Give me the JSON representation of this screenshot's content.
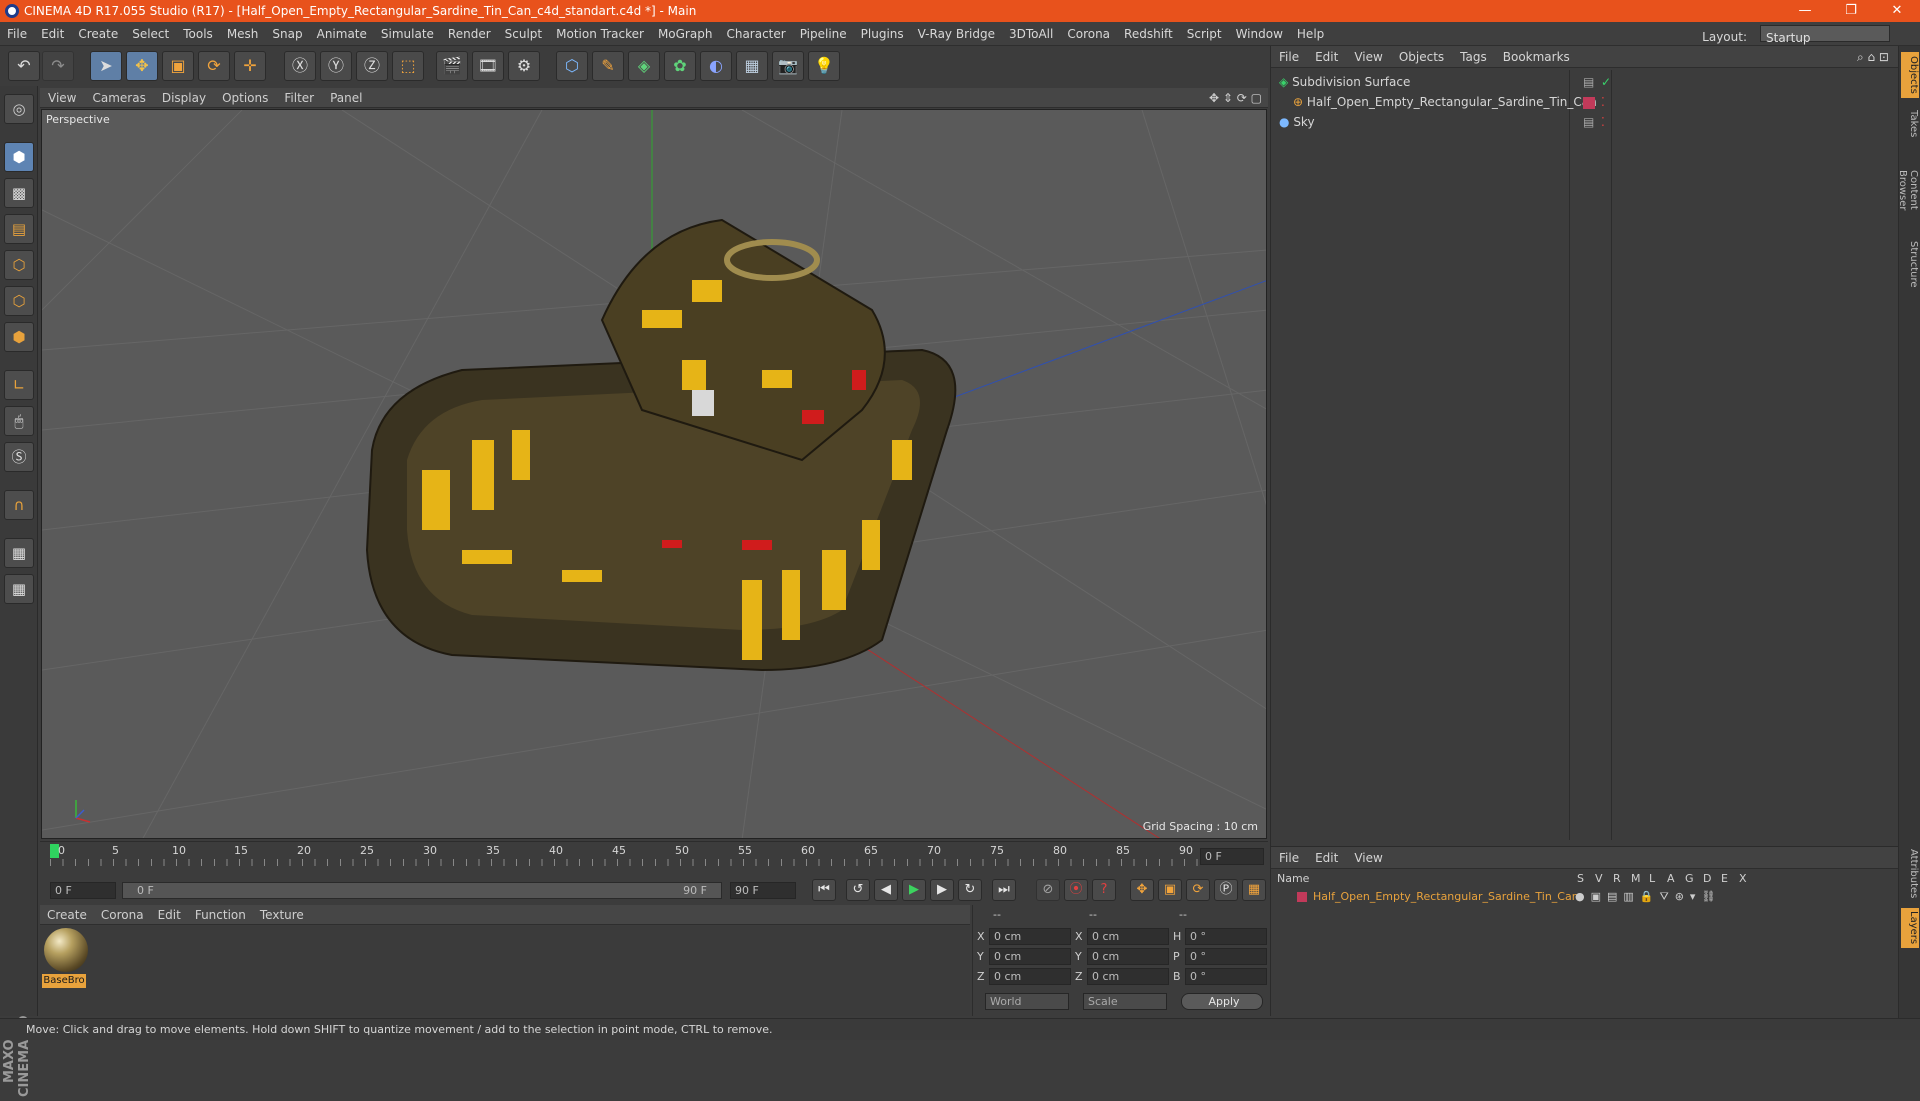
{
  "titlebar": {
    "title": "CINEMA 4D R17.055 Studio (R17) - [Half_Open_Empty_Rectangular_Sardine_Tin_Can_c4d_standart.c4d *] - Main",
    "minimize": "—",
    "restore": "❐",
    "close": "✕"
  },
  "menubar": {
    "items": [
      "File",
      "Edit",
      "Create",
      "Select",
      "Tools",
      "Mesh",
      "Snap",
      "Animate",
      "Simulate",
      "Render",
      "Sculpt",
      "Motion Tracker",
      "MoGraph",
      "Character",
      "Pipeline",
      "Plugins",
      "V-Ray Bridge",
      "3DToAll",
      "Corona",
      "Redshift",
      "Script",
      "Window",
      "Help"
    ],
    "layout_label": "Layout:",
    "layout_value": "Startup"
  },
  "viewport": {
    "menu": [
      "View",
      "Cameras",
      "Display",
      "Options",
      "Filter",
      "Panel"
    ],
    "label": "Perspective",
    "grid_spacing": "Grid Spacing : 10 cm"
  },
  "timeline": {
    "ticks": [
      "0",
      "5",
      "10",
      "15",
      "20",
      "25",
      "30",
      "35",
      "40",
      "45",
      "50",
      "55",
      "60",
      "65",
      "70",
      "75",
      "80",
      "85",
      "90"
    ],
    "frame_field": "0 F"
  },
  "transport": {
    "start": "0 F",
    "range_start": "0 F",
    "range_end": "90 F",
    "end": "90 F"
  },
  "material": {
    "menu": [
      "Create",
      "Corona",
      "Edit",
      "Function",
      "Texture"
    ],
    "name": "BaseBro"
  },
  "coordinates": {
    "header": [
      "--",
      "--",
      "--"
    ],
    "rows": [
      {
        "a": "X",
        "av": "0 cm",
        "b": "X",
        "bv": "0 cm",
        "c": "H",
        "cv": "0 °"
      },
      {
        "a": "Y",
        "av": "0 cm",
        "b": "Y",
        "bv": "0 cm",
        "c": "P",
        "cv": "0 °"
      },
      {
        "a": "Z",
        "av": "0 cm",
        "b": "Z",
        "bv": "0 cm",
        "c": "B",
        "cv": "0 °"
      }
    ],
    "world": "World",
    "scale": "Scale",
    "apply": "Apply"
  },
  "objects": {
    "menu": [
      "File",
      "Edit",
      "View",
      "Objects",
      "Tags",
      "Bookmarks"
    ],
    "items": [
      {
        "name": "Subdivision Surface"
      },
      {
        "name": "Half_Open_Empty_Rectangular_Sardine_Tin_Can"
      },
      {
        "name": "Sky"
      }
    ]
  },
  "attributes": {
    "menu": [
      "File",
      "Edit",
      "View"
    ],
    "header": "Name",
    "columns": [
      "S",
      "V",
      "R",
      "M",
      "L",
      "A",
      "G",
      "D",
      "E",
      "X"
    ],
    "row": "Half_Open_Empty_Rectangular_Sardine_Tin_Can"
  },
  "sidetabs": [
    "Objects",
    "Takes",
    "Content Browser",
    "Structure",
    "Attributes",
    "Layers"
  ],
  "maxon": "MAXON CINEMA 4D",
  "status": "Move: Click and drag to move elements. Hold down SHIFT to quantize movement / add to the selection in point mode, CTRL to remove."
}
